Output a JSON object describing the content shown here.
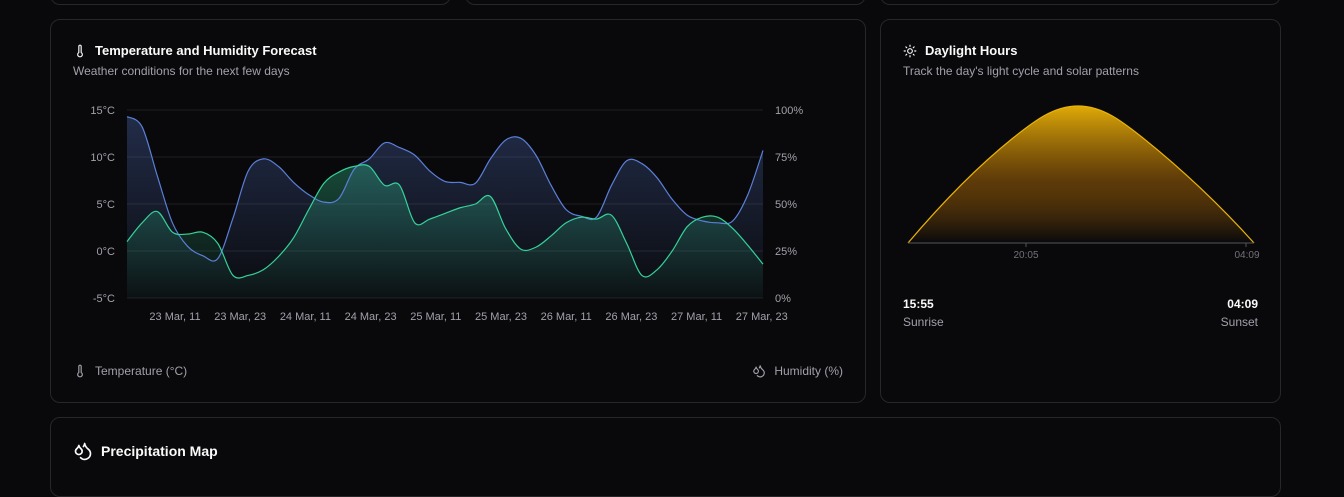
{
  "temp_card": {
    "title": "Temperature and Humidity Forecast",
    "description": "Weather conditions for the next few days",
    "legend_temperature": "Temperature (°C)",
    "legend_humidity": "Humidity (%)"
  },
  "daylight_card": {
    "title": "Daylight Hours",
    "description": "Track the day's light cycle and solar patterns",
    "axis_ticks": [
      "20:05",
      "04:09"
    ],
    "sunrise_time": "15:55",
    "sunrise_label": "Sunrise",
    "sunset_time": "04:09",
    "sunset_label": "Sunset",
    "sun_color": "#eab308"
  },
  "precip_card": {
    "title": "Precipitation Map"
  },
  "colors": {
    "temperature": "#5b7fd8",
    "humidity": "#34d399",
    "sun": "#eab308"
  },
  "chart_data": {
    "type": "area",
    "title": "Temperature and Humidity Forecast",
    "x_tick_labels": [
      "23 Mar, 11",
      "23 Mar, 23",
      "24 Mar, 11",
      "24 Mar, 23",
      "25 Mar, 11",
      "25 Mar, 23",
      "26 Mar, 11",
      "26 Mar, 23",
      "27 Mar, 11",
      "27 Mar, 23"
    ],
    "y_left": {
      "ticks": [
        "15°C",
        "10°C",
        "5°C",
        "0°C",
        "-5°C"
      ],
      "range": [
        -5,
        15
      ]
    },
    "y_right": {
      "ticks": [
        "100%",
        "75%",
        "50%",
        "25%",
        "0%"
      ],
      "range": [
        0,
        100
      ]
    },
    "x_hours": [
      0,
      3,
      6,
      9,
      12,
      15,
      18,
      21,
      24,
      27,
      30,
      33,
      36,
      39,
      42,
      45,
      48,
      51,
      54,
      57,
      60,
      63,
      66,
      69,
      72,
      75,
      78,
      81,
      84,
      87,
      90,
      93,
      96,
      99,
      102,
      105,
      108
    ],
    "series": [
      {
        "name": "Temperature (°C)",
        "axis": "left",
        "values": [
          14.3,
          13.2,
          8.0,
          3.0,
          0.5,
          -0.5,
          -0.8,
          3.5,
          8.5,
          9.8,
          9.0,
          7.3,
          6.0,
          5.2,
          5.6,
          8.7,
          9.8,
          11.5,
          11.0,
          10.2,
          8.5,
          7.4,
          7.3,
          7.2,
          9.8,
          11.8,
          12.0,
          10.2,
          7.0,
          4.4,
          3.7,
          3.6,
          7.0,
          9.6,
          9.3,
          7.8,
          5.5,
          3.8,
          3.2,
          3.0,
          3.2,
          6.0,
          10.7
        ],
        "humidity": [
          30,
          40,
          45,
          35,
          34,
          34,
          35,
          20,
          15,
          10,
          18,
          30,
          45,
          58,
          65,
          66,
          70,
          62,
          60,
          39,
          40,
          42,
          48,
          55,
          54,
          35,
          25,
          26,
          33,
          37,
          38,
          38,
          20,
          20,
          22,
          20,
          30,
          38,
          35,
          38,
          30,
          22,
          18
        ]
      },
      {
        "name": "Humidity (%)",
        "axis": "right",
        "values": [
          30,
          40,
          46,
          35,
          34,
          35,
          29,
          12,
          12,
          15,
          22,
          32,
          47,
          61,
          67,
          70,
          70,
          60,
          60,
          40,
          42,
          45,
          48,
          50,
          54,
          37,
          26,
          27,
          33,
          40,
          43,
          42,
          44,
          29,
          12,
          15,
          25,
          38,
          43,
          43,
          37,
          28,
          18
        ]
      }
    ],
    "grid": "horizontal",
    "legend": "bottom"
  }
}
